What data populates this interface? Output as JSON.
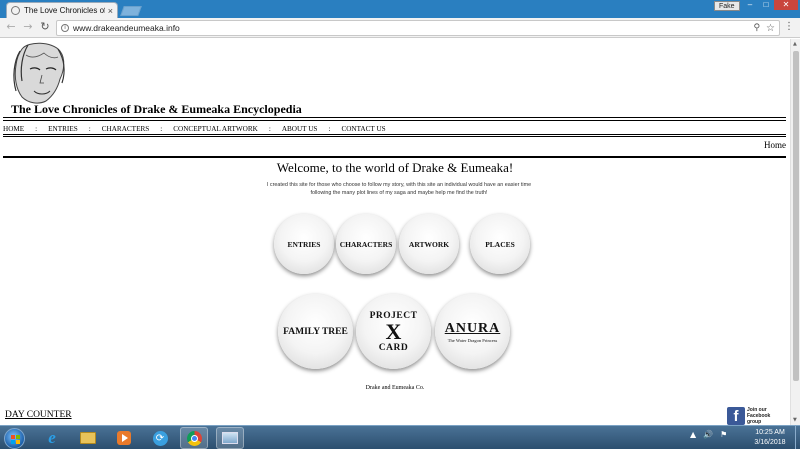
{
  "browser": {
    "tab_title": "The Love Chronicles of D",
    "tab_close": "×",
    "profile_label": "Fake",
    "window_min": "–",
    "window_max": "□",
    "window_close": "✕",
    "url": "www.drakeandeumeaka.info",
    "icons": {
      "back": "back-arrow-icon",
      "forward": "forward-arrow-icon",
      "reload": "reload-icon",
      "info": "info-icon",
      "zoom": "zoom-icon",
      "bookmark": "star-icon",
      "menu": "kebab-menu-icon"
    }
  },
  "site": {
    "title": "The Love Chronicles of Drake & Eumeaka Encyclopedia",
    "nav": [
      "HOME",
      "ENTRIES",
      "CHARACTERS",
      "CONCEPTUAL ARTWORK",
      "ABOUT US",
      "CONTACT US"
    ],
    "nav_separator": ":",
    "home_link": "Home",
    "welcome": "Welcome, to the world of Drake & Eumeaka!",
    "intro": "I created this site for those who choose to follow my story, with this site an individual would have an easier time following the many plot lines of my saga and maybe help me find the truth!",
    "circles_row1": [
      "ENTRIES",
      "CHARACTERS",
      "ARTWORK",
      "PLACES"
    ],
    "family_tree": "FAMILY TREE",
    "project_card": {
      "top": "PROJECT",
      "x": "X",
      "bottom": "CARD"
    },
    "anura": {
      "title": "ANURA",
      "subtitle": "The Water Dragon Princess"
    },
    "footer_company": "Drake and Eumeaka Co.",
    "day_counter": "DAY COUNTER",
    "facebook": {
      "icon": "f",
      "text": "Join our Facebook group"
    }
  },
  "taskbar": {
    "apps": [
      "internet-explorer",
      "file-explorer",
      "media-player",
      "sync-app",
      "chrome",
      "window"
    ],
    "time": "10:25 AM",
    "date": "3/16/2018",
    "tray_arrow": "▲",
    "tray_speaker": "🔊",
    "tray_flag": "⚑"
  },
  "colors": {
    "titlebar": "#2a7fc0",
    "facebook": "#3b5998",
    "close_button": "#c9463d"
  }
}
